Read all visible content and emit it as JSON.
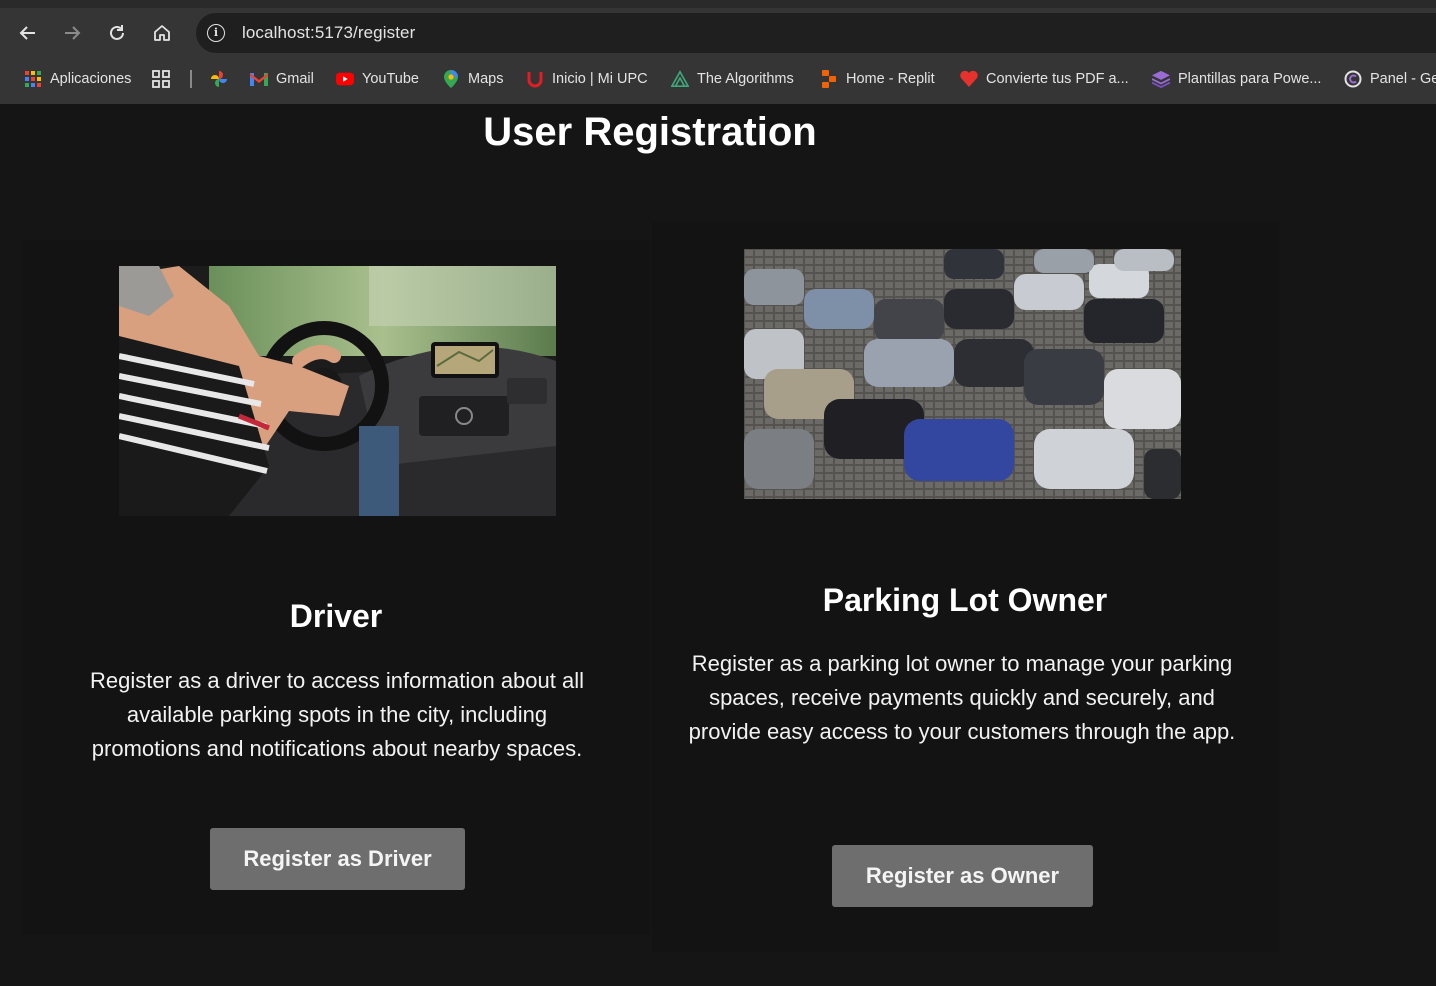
{
  "browser": {
    "url": "localhost:5173/register",
    "bookmarks": [
      {
        "label": "Aplicaciones",
        "icon": "apps-grid-icon"
      },
      {
        "label": "",
        "icon": "grid-icon"
      },
      {
        "label": "",
        "icon": "photos-icon"
      },
      {
        "label": "Gmail",
        "icon": "gmail-icon"
      },
      {
        "label": "YouTube",
        "icon": "youtube-icon"
      },
      {
        "label": "Maps",
        "icon": "maps-icon"
      },
      {
        "label": "Inicio | Mi UPC",
        "icon": "upc-icon"
      },
      {
        "label": "The Algorithms",
        "icon": "algorithms-icon"
      },
      {
        "label": "Home - Replit",
        "icon": "replit-icon"
      },
      {
        "label": "Convierte tus PDF a...",
        "icon": "pdf-heart-icon"
      },
      {
        "label": "Plantillas para Powe...",
        "icon": "slides-icon"
      },
      {
        "label": "Panel - Ge",
        "icon": "panel-icon"
      }
    ]
  },
  "page": {
    "title": "User Registration",
    "driver": {
      "heading": "Driver",
      "description": "Register as a driver to access information about all available parking spots in the city, including promotions and notifications about nearby spaces.",
      "button": "Register as Driver",
      "image": "photo of a driver at the steering wheel"
    },
    "owner": {
      "heading": "Parking Lot Owner",
      "description": "Register as a parking lot owner to manage your parking spaces, receive payments quickly and securely, and provide easy access to your customers through the app.",
      "button": "Register as Owner",
      "image": "photo of a crowded parking lot"
    }
  },
  "colors": {
    "background": "#151515",
    "card": "#131313",
    "button": "#6e6e6e",
    "chrome": "#353535"
  }
}
